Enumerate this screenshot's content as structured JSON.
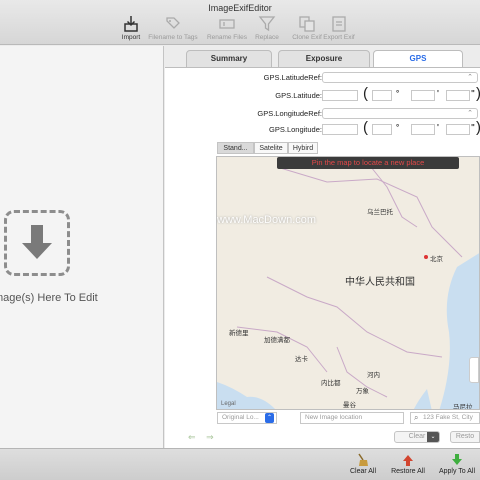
{
  "window": {
    "title": "ImageExifEditor"
  },
  "toolbar": {
    "items": [
      {
        "label": "Import"
      },
      {
        "label": "Filename to Tags"
      },
      {
        "label": "Rename Files"
      },
      {
        "label": "Replace"
      },
      {
        "label": "Clone Exif"
      },
      {
        "label": "Export Exif"
      }
    ]
  },
  "drop_zone": {
    "text": "mage(s) Here To Edit"
  },
  "tabs": [
    {
      "label": "Summary"
    },
    {
      "label": "Exposure"
    },
    {
      "label": "GPS",
      "active": true
    }
  ],
  "gps": {
    "latitude_ref_label": "GPS.LatitudeRef:",
    "latitude_label": "GPS.Latitude:",
    "longitude_ref_label": "GPS.LongitudeRef:",
    "longitude_label": "GPS.Longitude:",
    "open_paren": "(",
    "degree": "°",
    "minute": "'",
    "second": "\"",
    "close_paren": ")"
  },
  "map_types": [
    {
      "label": "Stand...",
      "active": true
    },
    {
      "label": "Satelite"
    },
    {
      "label": "Hybird"
    }
  ],
  "map": {
    "banner": "Pin the map to locate a new place",
    "country": "中华人民共和国",
    "cities": [
      "乌兰巴托",
      "北京",
      "新德里",
      "加德满都",
      "达卡",
      "内比都",
      "河内",
      "万象",
      "曼谷",
      "马尼拉"
    ],
    "legal": "Legal",
    "watermark": "www.MacDown.com"
  },
  "location_bar": {
    "original_select": "Original Lo...",
    "new_location_placeholder": "New Image location",
    "search_placeholder": "123 Fake St, City"
  },
  "panel_buttons": {
    "clear": "Clear",
    "restore": "Resto"
  },
  "footer": {
    "clear_all": "Clear All",
    "restore_all": "Restore All",
    "apply_to_all": "Apply To All"
  },
  "colors": {
    "accent": "#2a6ce8",
    "banner_text": "#e24848",
    "land": "#f1ece2",
    "water": "#c9def0"
  }
}
